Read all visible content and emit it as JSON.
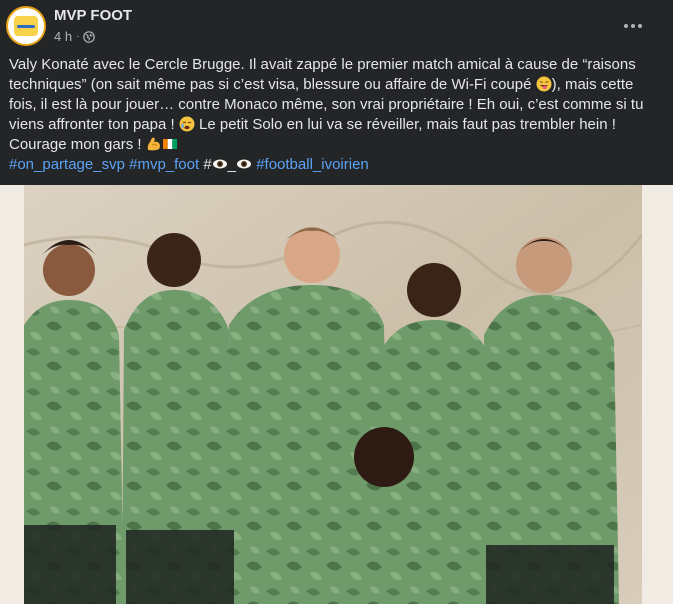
{
  "post": {
    "page_name": "MVP FOOT",
    "timestamp": "4 h",
    "separator": "·",
    "avatar_text": "MVP Foot",
    "more_label": "···",
    "caption": {
      "line1": "Valy Konaté avec le Cercle Brugge. Il avait zappé le premier match amical à cause de “raisons techniques” (on sait même pas si c’est visa, blessure ou affaire de Wi-Fi coupé ",
      "line1_end": "), mais cette fois, il est là pour jouer… contre Monaco même, son vrai propriétaire ! Eh oui, c’est comme si tu viens affronter ton papa ! ",
      "line2": " Le petit Solo en lui va se réveiller, mais faut pas trembler hein ! Courage mon gars ! "
    },
    "hashtags": {
      "tag1": "#on_partage_svp",
      "tag2": "#mvp_foot",
      "hash_prefix": "#",
      "eyes_sep": "_",
      "tag3": "#football_ivoirien"
    },
    "colors": {
      "background": "#242526",
      "text": "#e4e6eb",
      "secondary": "#b0b3b8",
      "link": "#5ba2f5",
      "photo_frame": "#f0ebe3"
    },
    "icons": [
      "globe-icon",
      "more-options-icon",
      "tongue-emoji-icon",
      "crying-emoji-icon",
      "flexed-biceps-emoji-icon",
      "ivory-coast-flag-emoji-icon",
      "eye-emoji-icon"
    ]
  }
}
